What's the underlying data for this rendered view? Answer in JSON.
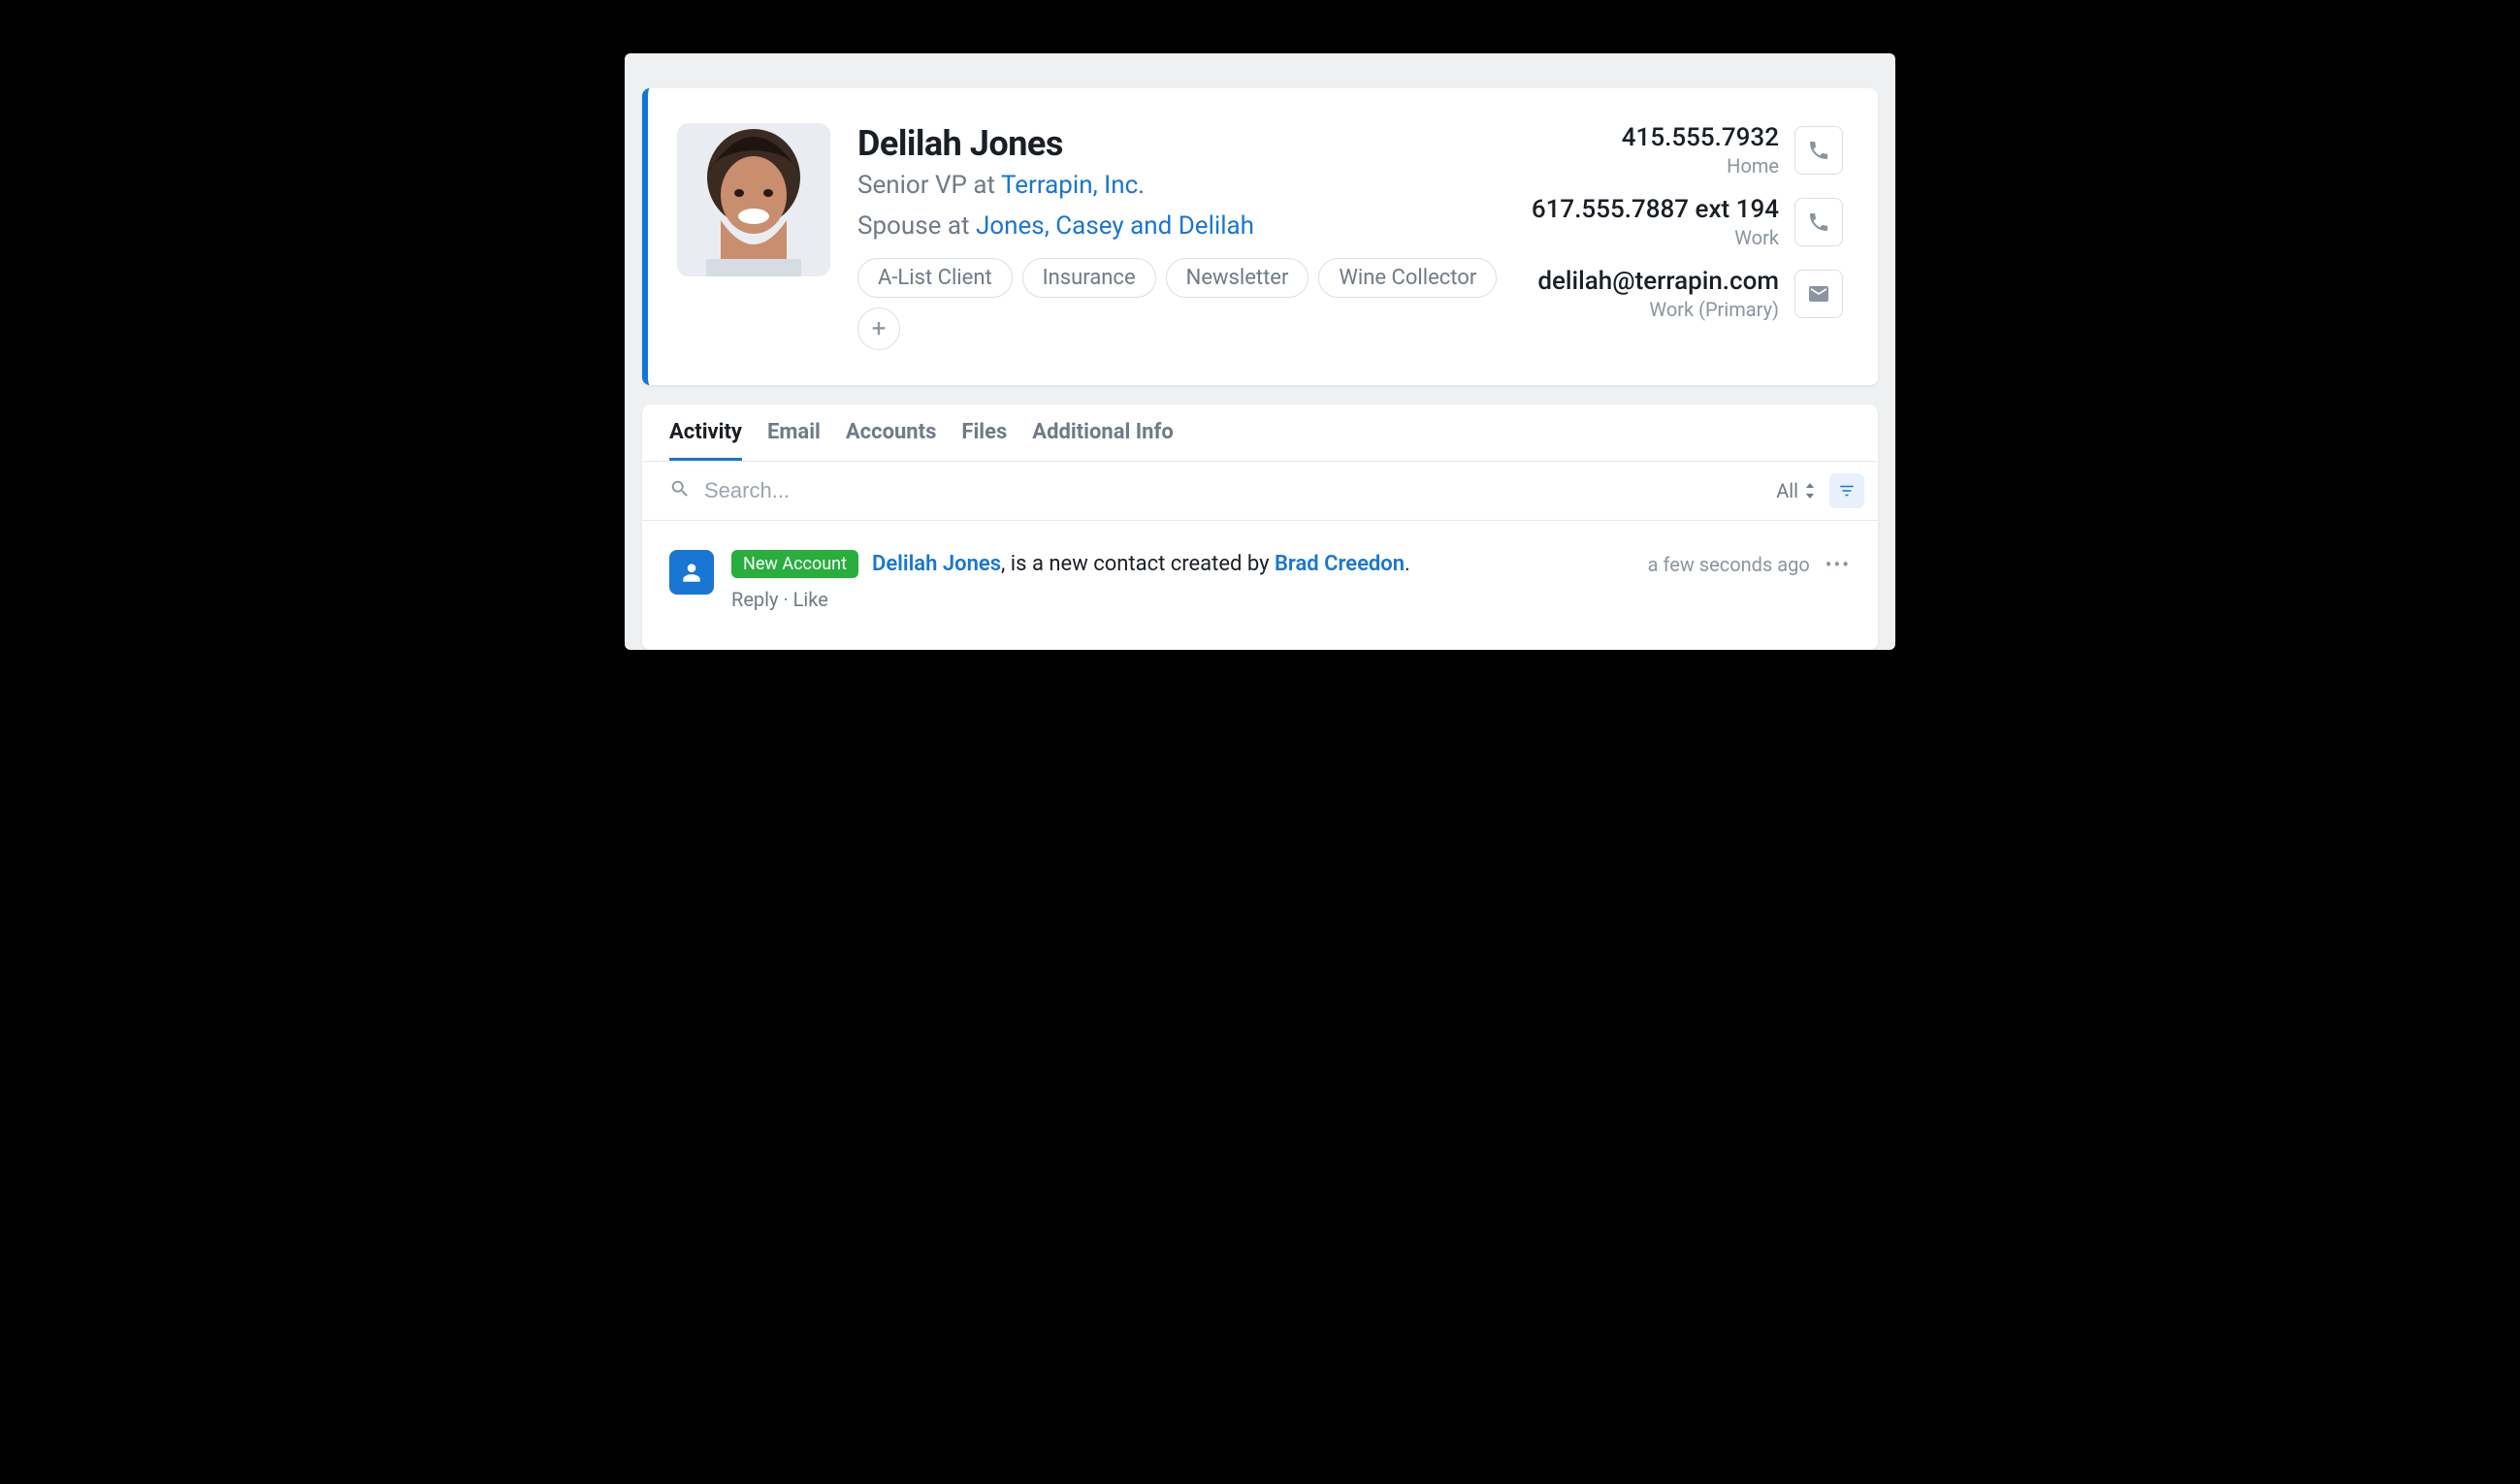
{
  "contact": {
    "name": "Delilah Jones",
    "roles": [
      {
        "prefix": "Senior VP at ",
        "link": "Terrapin, Inc."
      },
      {
        "prefix": "Spouse at ",
        "link": "Jones, Casey and Delilah"
      }
    ],
    "tags": [
      "A-List Client",
      "Insurance",
      "Newsletter",
      "Wine Collector"
    ],
    "add_tag_icon": "+"
  },
  "methods": [
    {
      "value": "415.555.7932",
      "label": "Home",
      "icon": "phone"
    },
    {
      "value": "617.555.7887 ext 194",
      "label": "Work",
      "icon": "phone"
    },
    {
      "value": "delilah@terrapin.com",
      "label": "Work (Primary)",
      "icon": "mail"
    }
  ],
  "tabs": [
    "Activity",
    "Email",
    "Accounts",
    "Files",
    "Additional Info"
  ],
  "active_tab": "Activity",
  "search": {
    "placeholder": "Search...",
    "filter_label": "All"
  },
  "feed": [
    {
      "icon": "person",
      "badge": "New Account",
      "subject_link": "Delilah Jones",
      "middle_text": ", is a new contact created by ",
      "author_link": "Brad Creedon",
      "suffix": ".",
      "time": "a few seconds ago",
      "actions": {
        "reply": "Reply",
        "sep": " · ",
        "like": "Like"
      }
    }
  ]
}
